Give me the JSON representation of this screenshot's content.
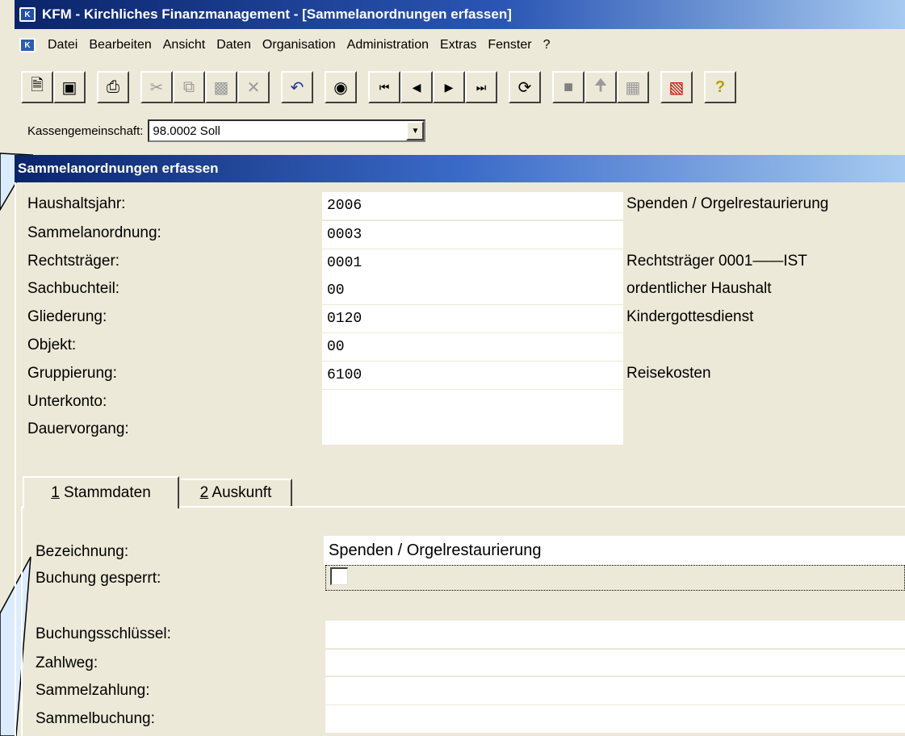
{
  "window": {
    "title": "KFM - Kirchliches Finanzmanagement - [Sammelanordnungen erfassen]",
    "app_icon": "K"
  },
  "menu": [
    "Datei",
    "Bearbeiten",
    "Ansicht",
    "Daten",
    "Organisation",
    "Administration",
    "Extras",
    "Fenster",
    "?"
  ],
  "toolbar": {
    "icons": [
      "new-icon",
      "save-icon",
      "print-icon",
      "cut-icon",
      "copy-icon",
      "paste-icon",
      "delete-icon",
      "undo-icon",
      "find-icon",
      "first-record-icon",
      "previous-record-icon",
      "next-record-icon",
      "last-record-icon",
      "refresh-icon",
      "stop-icon",
      "up-arrow-icon",
      "tree-icon",
      "report-icon",
      "help-icon"
    ]
  },
  "kasse": {
    "label": "Kassengemeinschaft:",
    "value": "98.0002  Soll"
  },
  "form": {
    "title": "Sammelanordnungen erfassen",
    "fields": [
      {
        "label": "Haushaltsjahr:",
        "value": "2006",
        "desc": "Spenden / Orgelrestaurierung"
      },
      {
        "label": "Sammelanordnung:",
        "value": "0003",
        "desc": ""
      },
      {
        "label": "Rechtsträger:",
        "value": "0001",
        "desc": "Rechtsträger 0001——IST"
      },
      {
        "label": "Sachbuchteil:",
        "value": "00",
        "desc": "ordentlicher Haushalt"
      },
      {
        "label": "Gliederung:",
        "value": "0120",
        "desc": "Kindergottesdienst"
      },
      {
        "label": "Objekt:",
        "value": "00",
        "desc": ""
      },
      {
        "label": "Gruppierung:",
        "value": "6100",
        "desc": "Reisekosten"
      },
      {
        "label": "Unterkonto:",
        "value": "",
        "desc": ""
      },
      {
        "label": "Dauervorgang:",
        "value": "",
        "desc": ""
      }
    ]
  },
  "tabs": [
    {
      "num": "1",
      "label": " Stammdaten"
    },
    {
      "num": "2",
      "label": " Auskunft"
    }
  ],
  "stammdaten": {
    "bezeichnung_label": "Bezeichnung:",
    "bezeichnung_value": "Spenden / Orgelrestaurierung",
    "gesperrt_label": "Buchung gesperrt:",
    "gesperrt_checked": false,
    "lower_fields": [
      {
        "label": "Buchungsschlüssel:",
        "value": ""
      },
      {
        "label": "Zahlweg:",
        "value": ""
      },
      {
        "label": "Sammelzahlung:",
        "value": ""
      },
      {
        "label": "Sammelbuchung:",
        "value": ""
      }
    ]
  }
}
